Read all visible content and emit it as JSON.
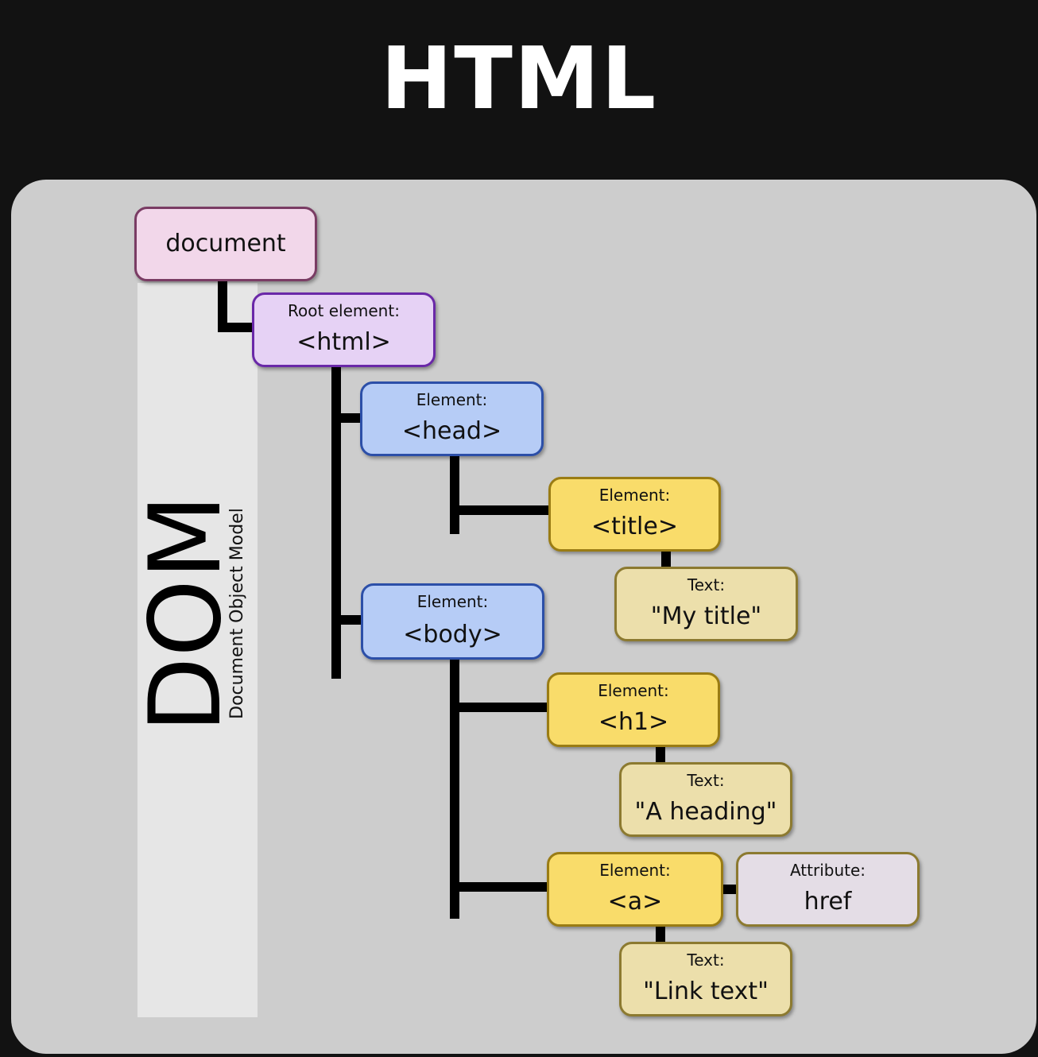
{
  "title": "HTML",
  "sidebar": {
    "acronym": "DOM",
    "full_name": "Document Object Model"
  },
  "nodes": {
    "document": {
      "value": "document"
    },
    "html": {
      "kind": "Root element:",
      "value": "<html>"
    },
    "head": {
      "kind": "Element:",
      "value": "<head>"
    },
    "title": {
      "kind": "Element:",
      "value": "<title>"
    },
    "title_text": {
      "kind": "Text:",
      "value": "\"My title\""
    },
    "body": {
      "kind": "Element:",
      "value": "<body>"
    },
    "h1": {
      "kind": "Element:",
      "value": "<h1>"
    },
    "h1_text": {
      "kind": "Text:",
      "value": "\"A heading\""
    },
    "a": {
      "kind": "Element:",
      "value": "<a>"
    },
    "a_attr": {
      "kind": "Attribute:",
      "value": "href"
    },
    "a_text": {
      "kind": "Text:",
      "value": "\"Link text\""
    }
  },
  "colors": {
    "background": "#121212",
    "panel": "#cdcdcd",
    "document": "#f2d7ea",
    "root_element": "#e6d2f5",
    "structural_element": "#b6ccf6",
    "content_element": "#f9dc6a",
    "text_node": "#ecdfab",
    "attribute_node": "#e4dde6"
  }
}
